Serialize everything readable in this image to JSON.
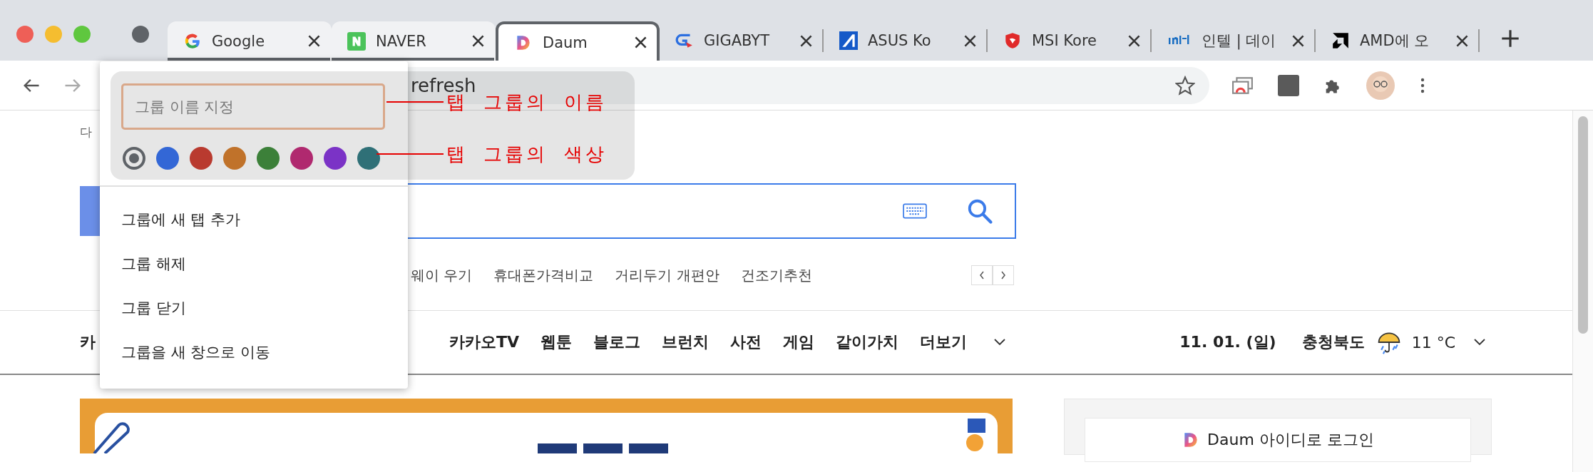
{
  "tab_group": {
    "color": "#5f6368"
  },
  "tabs": [
    {
      "title": "Google",
      "selected": false,
      "in_group": true
    },
    {
      "title": "NAVER",
      "selected": false,
      "in_group": true
    },
    {
      "title": "Daum",
      "selected": true,
      "in_group": true
    },
    {
      "title": "GIGABYT",
      "selected": false,
      "in_group": false
    },
    {
      "title": "ASUS Ko",
      "selected": false,
      "in_group": false
    },
    {
      "title": "MSI Kore",
      "selected": false,
      "in_group": false
    },
    {
      "title": "인텔 | 데이",
      "selected": false,
      "in_group": false
    },
    {
      "title": "AMD에 오",
      "selected": false,
      "in_group": false
    }
  ],
  "toolbar": {
    "address": "refresh"
  },
  "group_popup": {
    "name_field": {
      "placeholder": "그룹 이름 지정"
    },
    "colors": [
      {
        "color": "#5f6368",
        "selected": true
      },
      {
        "color": "#3367d6",
        "selected": false
      },
      {
        "color": "#b93a2f",
        "selected": false
      },
      {
        "color": "#c0722a",
        "selected": false
      },
      {
        "color": "#3c8039",
        "selected": false
      },
      {
        "color": "#b0296f",
        "selected": false
      },
      {
        "color": "#7b33c6",
        "selected": false
      },
      {
        "color": "#2f7077",
        "selected": false
      }
    ],
    "menu": [
      "그룹에 새 탭 추가",
      "그룹 해제",
      "그룹 닫기",
      "그룹을 새 창으로 이동"
    ]
  },
  "annotations": [
    "탭 그룹의 이름",
    "탭 그룹의 색상"
  ],
  "page": {
    "top_text": "다",
    "suggestions": [
      "웨이 우기",
      "휴대폰가격비교",
      "거리두기 개편안",
      "건조기추천"
    ],
    "nav_first": "카",
    "nav": [
      "카카오TV",
      "웹툰",
      "블로그",
      "브런치",
      "사전",
      "게임",
      "같이가치",
      "더보기"
    ],
    "date": "11. 01. (일)",
    "region": "충청북도",
    "temperature": "11 °C",
    "login": "Daum 아이디로 로그인"
  }
}
